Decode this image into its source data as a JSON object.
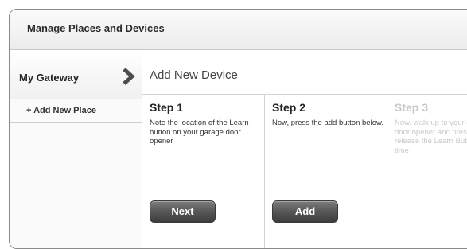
{
  "header": {
    "title": "Manage Places and Devices"
  },
  "sidebar": {
    "gateway_label": "My Gateway",
    "gateway_icon": "chevron-right-icon",
    "add_place_label": "+ Add New Place"
  },
  "main": {
    "title": "Add New Device",
    "steps": [
      {
        "title": "Step 1",
        "description": "Note the location of the Learn button on your garage door opener",
        "button_label": "Next"
      },
      {
        "title": "Step 2",
        "description": "Now, press the add button below.",
        "button_label": "Add"
      },
      {
        "title": "Step 3",
        "description": "Now, walk up to your garage door opener and press and release the Learn Button one time"
      }
    ]
  },
  "colors": {
    "button": "#4a4a4a",
    "border": "#8a8a8a",
    "faded_text": "#c8c8c8"
  }
}
